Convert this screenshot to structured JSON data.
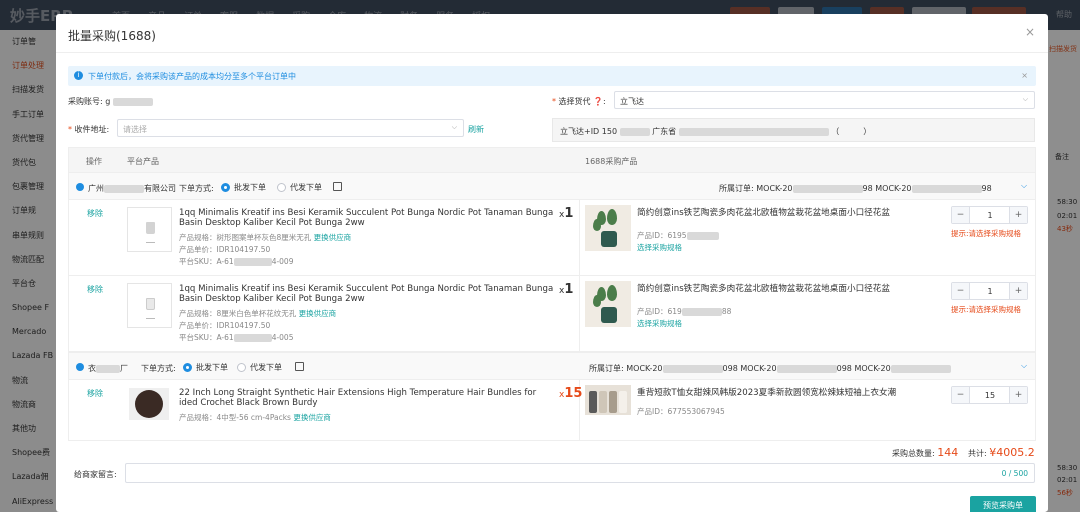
{
  "app": {
    "logo": "妙手ERP",
    "nav": [
      "首页",
      "产品",
      "订单",
      "客服",
      "数据",
      "采购",
      "仓库",
      "物流",
      "财务",
      "服务",
      "授权"
    ],
    "top_right": "帮助"
  },
  "sidebar": {
    "items": [
      "订单管",
      "订单处理",
      "扫描发货",
      "手工订单",
      "货代管理",
      "货代包",
      "包裹管理",
      "订单规",
      "串单规则",
      "物流匹配",
      "平台仓",
      "Shopee F",
      "Mercado",
      "Lazada FB",
      "物流",
      "物流商",
      "其他功",
      "Shopee费",
      "Lazada佣",
      "AliExpress"
    ],
    "active_index": 1
  },
  "right_strip": {
    "tag": "扫描发货",
    "note_label": "备注",
    "times": [
      "58:30",
      "02:01",
      "43秒",
      "58:30",
      "02:01",
      "56秒"
    ]
  },
  "modal": {
    "title": "批量采购(1688)",
    "close_symbol": "×",
    "notice": "下单付款后，会将采购该产品的成本均分至多个平台订单中",
    "notice_close": "×",
    "account_label": "采购账号:",
    "account_value": "g",
    "forwarder_label": "选择货代",
    "forwarder_value": "立飞达",
    "receiver_label": "收件地址:",
    "receiver_placeholder": "请选择",
    "refresh_label": "刷新",
    "address_value_pre": "立飞达+ID 150",
    "address_value_mid": "广东省",
    "columns": {
      "action": "操作",
      "platform_product": "平台产品",
      "sourcing_product": "1688采购产品"
    },
    "mode_label": "下单方式:",
    "mode_wholesale": "批发下单",
    "mode_proxy": "代发下单",
    "orders_label": "所属订单:",
    "remove_label": "移除",
    "spec_link": "更换供应商",
    "select_spec_link": "选择采购规格",
    "warn": "提示:请选择采购规格",
    "suppliers": [
      {
        "name_pre": "广州",
        "name_post": "有限公司",
        "orders": [
          "MOCK-20",
          "98",
          "MOCK-20",
          "98"
        ],
        "products": [
          {
            "title": "1qq Minimalis Kreatif ins Besi Keramik Succulent Pot Bunga Nordic Pot Tanaman Bunga Basin Desktop Kaliber Kecil Pot Bunga 2ww",
            "qty_prefix": "x",
            "qty": "1",
            "spec": "产品规格：树形图案单杯灰色8厘米无孔",
            "price": "产品单价：IDR104197.50",
            "sku_pre": "平台SKU：A-61",
            "sku_post": "4-009",
            "src_title": "简约创意ins铁艺陶瓷多肉花盆北欧植物盆栽花盆地桌面小口径花盆",
            "src_id_pre": "产品ID：6195",
            "src_id_post": "",
            "stepper_value": "1"
          },
          {
            "title": "1qq Minimalis Kreatif ins Besi Keramik Succulent Pot Bunga Nordic Pot Tanaman Bunga Basin Desktop Kaliber Kecil Pot Bunga 2ww",
            "qty_prefix": "x",
            "qty": "1",
            "spec": "产品规格：8厘米白色单杯花纹无孔",
            "price": "产品单价：IDR104197.50",
            "sku_pre": "平台SKU：A-61",
            "sku_post": "4-005",
            "src_title": "简约创意ins铁艺陶瓷多肉花盆北欧植物盆栽花盆地桌面小口径花盆",
            "src_id_pre": "产品ID：619",
            "src_id_post": "88",
            "stepper_value": "1"
          }
        ]
      },
      {
        "name_pre": "衣",
        "name_post": "厂",
        "orders": [
          "MOCK-20",
          "098",
          "MOCK-20",
          "098",
          "MOCK-20"
        ],
        "products": [
          {
            "title": "22 Inch Long Straight Synthetic Hair Extensions High Temperature Hair Bundles for ided Crochet Black Brown Burdy",
            "qty_prefix": "x",
            "qty": "15",
            "spec": "产品规格：4中型-56 cm-4Packs",
            "src_title": "重背短款T恤女甜辣风韩版2023夏季新款圆领宽松辣妹短袖上衣女潮",
            "src_id_pre": "产品ID：677553067945",
            "src_id_post": "",
            "stepper_value": "15"
          }
        ]
      }
    ],
    "total_qty_label": "采购总数量:",
    "total_qty": "144",
    "total_label": "共计:",
    "total_amount": "¥4005.2",
    "message_label": "给商家留言:",
    "message_count": "0 / 500",
    "preview_button": "预览采购单"
  }
}
